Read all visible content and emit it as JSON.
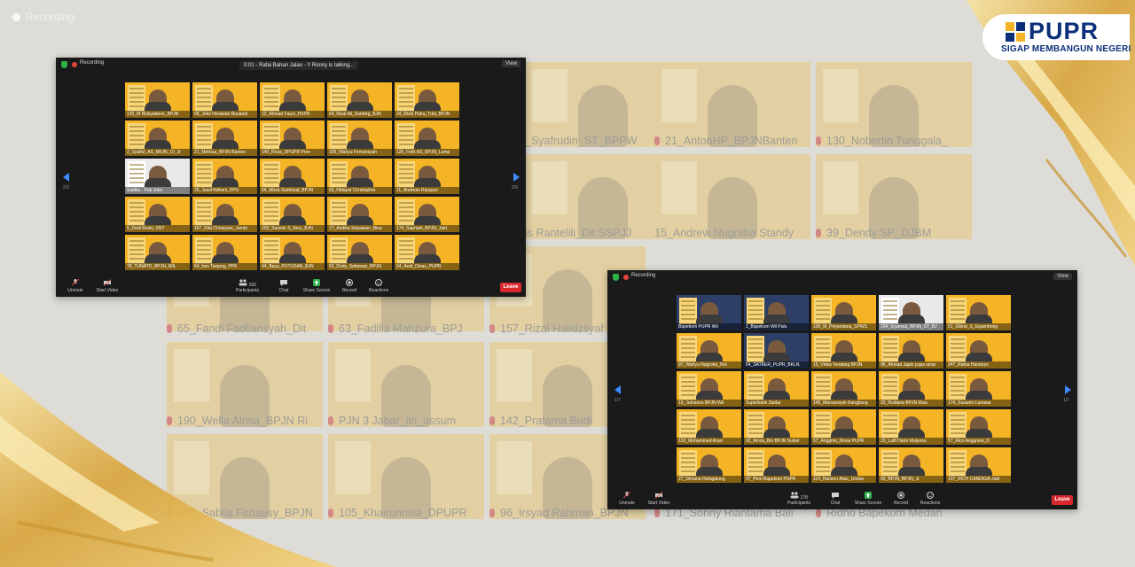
{
  "recording_label": "Recording",
  "logo": {
    "name": "PUPR",
    "tagline": "SIGAP MEMBANGUN NEGERI"
  },
  "background_names": [
    "_Syafrudin_ST_BPPW",
    "21_AntonHP_BPJNBanten",
    "130_Nobertin Tunggala_",
    "is Rantelili_Dit SSPJJ",
    "15_Andrew Nugraha Standy",
    "39_Dendy SP_DJBM",
    "65_Fandi Fadliansyah_Dit",
    "63_Fadilla Mahzura_BPJ",
    "157_Rizal Halidzsyah",
    "190_Wella Alrisa_BPJN Ri",
    "PJN 3 Jabar_iin_assum",
    "142_Pratama Budi",
    "165_Sabila Firdausy_BPJN",
    "105_Khairunnisa_DPUPR",
    "96_Irsyad Rahman_BPJN",
    "171_Sonny Riantama Bali",
    "Ridho Bapekom Medan"
  ],
  "window1": {
    "recording": "Recording",
    "talking": "0:01 - Rafai Bahan Jalan - Y Ronny is talking...",
    "view": "View",
    "page_left": "2/3",
    "page_right": "2/3",
    "tiles": [
      "125_M Rizkyadene_BPJN",
      "58_Joko Herawan Rusandi",
      "12_Ahmad Fauzi_PUPR",
      "64_Rizal Ali_Sumbrg_BJN",
      "34_Rizki Putra_Tubi_BPJN",
      "2_Syaiful_AS_BBJN_10_Jt",
      "21_Melissa_BPJN Banten",
      "140_Reza_DPUPR Prov",
      "155_Wahyu Firmansyah",
      "125_Felix AS_BPJN_Lamp",
      "Sadiku - Pak Joko",
      "26_Jusuf Adhani_DPU",
      "54_Mirza Syahrizal_BPJN",
      "65_Hidayat Christopher",
      "11_Andreas Ranguei",
      "5_Dedi Rezki_SNT",
      "157_Rita Christyani_Jambi",
      "103_Savenk S_Arus_BJN",
      "17_Andika Setyawan_Bina",
      "174_Sapniah_BPJN_Jakt",
      "78_TUNATO_BPJN_WIL",
      "64_Iron Tanjung_PPK",
      "44_Bayu_PUTUSAN_BJN",
      "55_Dody_Setiawan_BPJN",
      "54_Andi_Dinas_PUPR"
    ],
    "toolbar": {
      "unmute": "Unmute",
      "start_video": "Start Video",
      "participants": "Participants",
      "participants_count": "166",
      "chat": "Chat",
      "share_screen": "Share Screen",
      "record": "Record",
      "reactions": "Reactions",
      "leave": "Leave"
    }
  },
  "window2": {
    "recording": "Recording",
    "view": "View",
    "page_left": "1/7",
    "page_right": "1/7",
    "tiles": [
      "Bapekom PUPR Wil",
      "1_Bapekom Wil Palu",
      "126_M_Priyandana_SPWS",
      "104_Syamsul_BPJN_ST_BJ",
      "51_Gibral_S_Equenbring",
      "97_Wahyu Nugroho_Rol",
      "54_SATKER_PUPR_BKLN",
      "15_Vinka Tendang BPJN",
      "96_Ahmad Japin pupa sinar",
      "247_Ratna Handoyo",
      "19_Jumarius BPJN Wil",
      "Superbank Zaidar",
      "145_Manussiyah Kangkung",
      "32_Rudiana BPJN Riau",
      "174_Susanto Lunawa",
      "102_Mohammed Anuri",
      "92_Amos_Bin BPJN Sulsel",
      "57_Anggrini_Dinas PUPR",
      "15_Lutfi Harto Mulyono",
      "57_Rico Anggraini_D",
      "27_Dimana Hutagalung",
      "97_Pem Bapekom PUPR",
      "114_Hanzon Alias_Undan",
      "50_BPJN_BPJN_Jt",
      "137_RICH CANDIGA-Jakt"
    ],
    "toolbar": {
      "unmute": "Unmute",
      "start_video": "Start Video",
      "participants": "Participants",
      "participants_count": "178",
      "chat": "Chat",
      "share_screen": "Share Screen",
      "record": "Record",
      "reactions": "Reactions",
      "leave": "Leave"
    }
  },
  "colors": {
    "accent": "#f4b425",
    "leave": "#d8272d",
    "share": "#2db34a",
    "logo_blue": "#0c2f7a"
  }
}
